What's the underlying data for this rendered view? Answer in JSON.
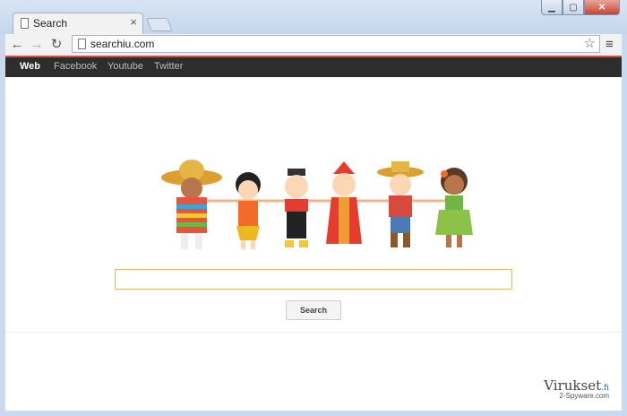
{
  "browser": {
    "tab_title": "Search",
    "url": "searchiu.com"
  },
  "navbar": {
    "items": [
      {
        "label": "Web"
      },
      {
        "label": "Facebook"
      },
      {
        "label": "Youtube"
      },
      {
        "label": "Twitter"
      }
    ]
  },
  "main": {
    "search_button": "Search",
    "search_placeholder": ""
  },
  "watermark": {
    "brand": "Virukset",
    "brand_suffix": ".fi",
    "sub": "2-Spyware.com"
  },
  "colors": {
    "accent": "#dd4b39",
    "navbar_bg": "#2d2d2d"
  }
}
